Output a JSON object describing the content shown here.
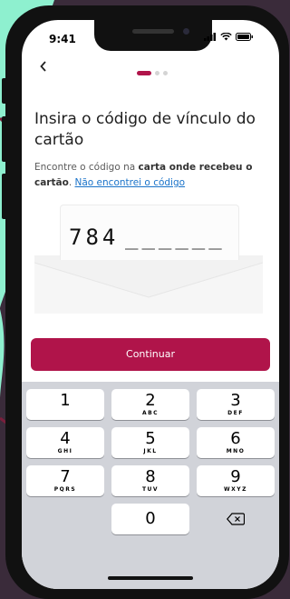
{
  "status": {
    "time": "9:41"
  },
  "title": "Insira o código de vínculo do cartão",
  "subtitle": {
    "part1": "Encontre o código na ",
    "bold": "carta onde recebeu o cartão",
    "part2": ". ",
    "link": "Não encontrei o código"
  },
  "code": {
    "entered": "784",
    "placeholder": "______"
  },
  "continue_label": "Continuar",
  "keyboard": {
    "k1": {
      "num": "1",
      "letters": ""
    },
    "k2": {
      "num": "2",
      "letters": "ABC"
    },
    "k3": {
      "num": "3",
      "letters": "DEF"
    },
    "k4": {
      "num": "4",
      "letters": "GHI"
    },
    "k5": {
      "num": "5",
      "letters": "JKL"
    },
    "k6": {
      "num": "6",
      "letters": "MNO"
    },
    "k7": {
      "num": "7",
      "letters": "PQRS"
    },
    "k8": {
      "num": "8",
      "letters": "TUV"
    },
    "k9": {
      "num": "9",
      "letters": "WXYZ"
    },
    "k0": {
      "num": "0"
    }
  },
  "colors": {
    "accent": "#b0144a",
    "link": "#1a73c9",
    "background_mint": "#8ef0cf"
  },
  "icons": {
    "back": "back-chevron-icon",
    "delete": "backspace-icon"
  }
}
